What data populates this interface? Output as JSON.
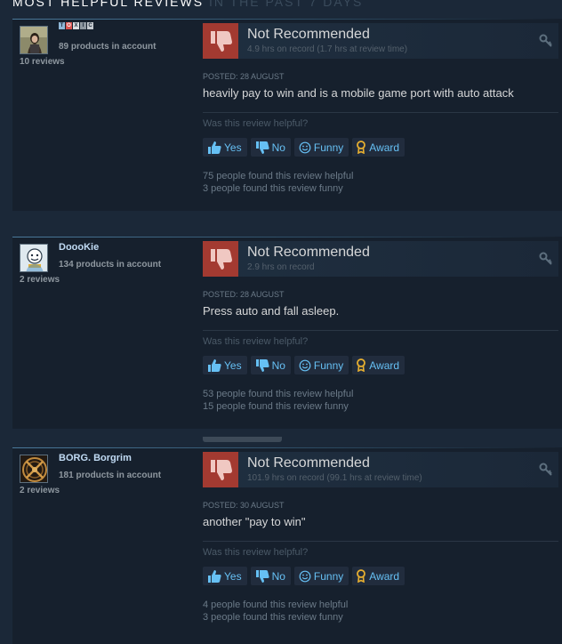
{
  "header": {
    "title": "Most Helpful Reviews",
    "subtitle": "in the past 7 days"
  },
  "common": {
    "verdict": "Not Recommended",
    "helpful_question": "Was this review helpful?",
    "yes_label": "Yes",
    "no_label": "No",
    "funny_label": "Funny",
    "award_label": "Award"
  },
  "reviews": [
    {
      "author_name": "TOXIC",
      "products": "89 products in account",
      "review_count": "10 reviews",
      "hours": "4.9 hrs on record (1.7 hrs at review time)",
      "posted": "Posted: 28 August",
      "text": "heavily pay to win and is a mobile game port with auto attack",
      "helpful_stat": "75 people found this review helpful",
      "funny_stat": "3 people found this review funny"
    },
    {
      "author_name": "DoooKie",
      "products": "134 products in account",
      "review_count": "2 reviews",
      "hours": "2.9 hrs on record",
      "posted": "Posted: 28 August",
      "text": "Press auto and fall asleep.",
      "helpful_stat": "53 people found this review helpful",
      "funny_stat": "15 people found this review funny"
    },
    {
      "author_name": "BORG. Borgrim",
      "products": "181 products in account",
      "review_count": "2 reviews",
      "hours": "101.9 hrs on record (99.1 hrs at review time)",
      "posted": "Posted: 30 August",
      "text": "another \"pay to win\"",
      "helpful_stat": "4 people found this review helpful",
      "funny_stat": "3 people found this review funny"
    }
  ],
  "colors": {
    "negative": "#a33a31",
    "link": "#66c0f4",
    "award": "#e8b030"
  }
}
